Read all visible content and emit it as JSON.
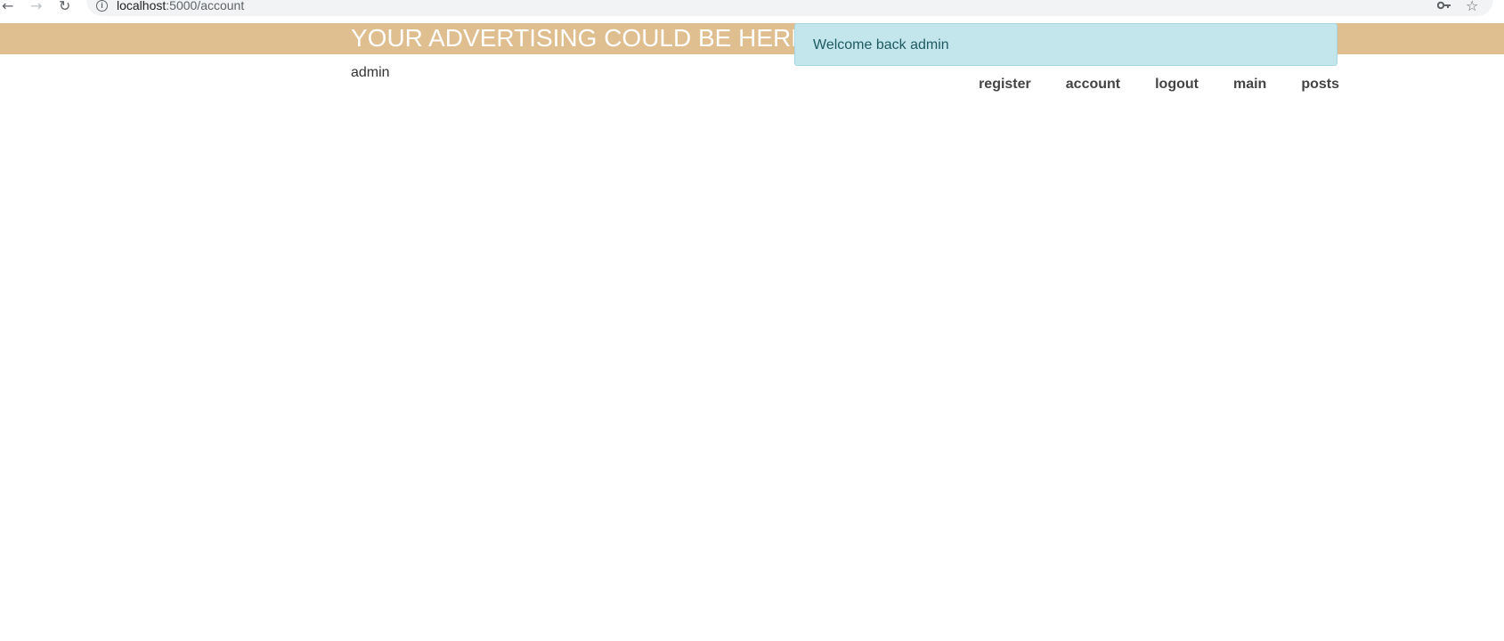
{
  "browser": {
    "url_host": "localhost",
    "url_path": ":5000/account"
  },
  "banner": {
    "text": "YOUR ADVERTISING COULD BE HERE"
  },
  "alert": {
    "message": "Welcome back admin"
  },
  "user": {
    "name": "admin"
  },
  "nav": {
    "items": [
      {
        "label": "register"
      },
      {
        "label": "account"
      },
      {
        "label": "logout"
      },
      {
        "label": "main"
      },
      {
        "label": "posts"
      }
    ]
  },
  "colors": {
    "banner_bg": "#dfbe90",
    "alert_bg": "#c2e6ec",
    "alert_text": "#1f5962"
  }
}
